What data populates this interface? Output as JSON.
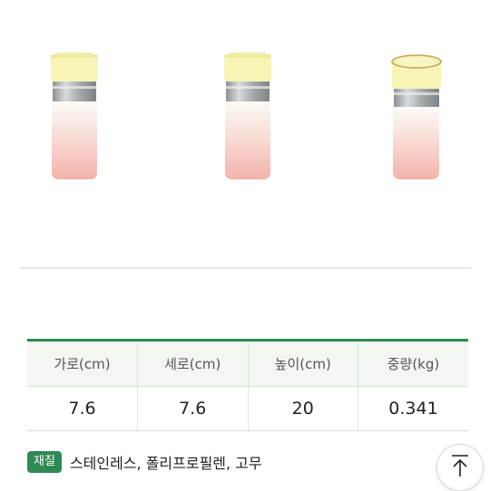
{
  "product_views": [
    "front-view",
    "front-view",
    "angled-view"
  ],
  "specs": {
    "headers": [
      "가로(cm)",
      "세로(cm)",
      "높이(cm)",
      "중량(kg)"
    ],
    "values": [
      "7.6",
      "7.6",
      "20",
      "0.341"
    ]
  },
  "material": {
    "badge": "재질",
    "text": "스테인레스, 폴리프로필렌, 고무"
  },
  "colors": {
    "accent": "#2e8a55",
    "lid": "#f7f4b6",
    "band": "#b9bcbf",
    "body_top": "#ffffff",
    "body_bottom": "#f3b9b1"
  },
  "icons": {
    "scroll_top": "arrow-up-to-top-icon"
  }
}
